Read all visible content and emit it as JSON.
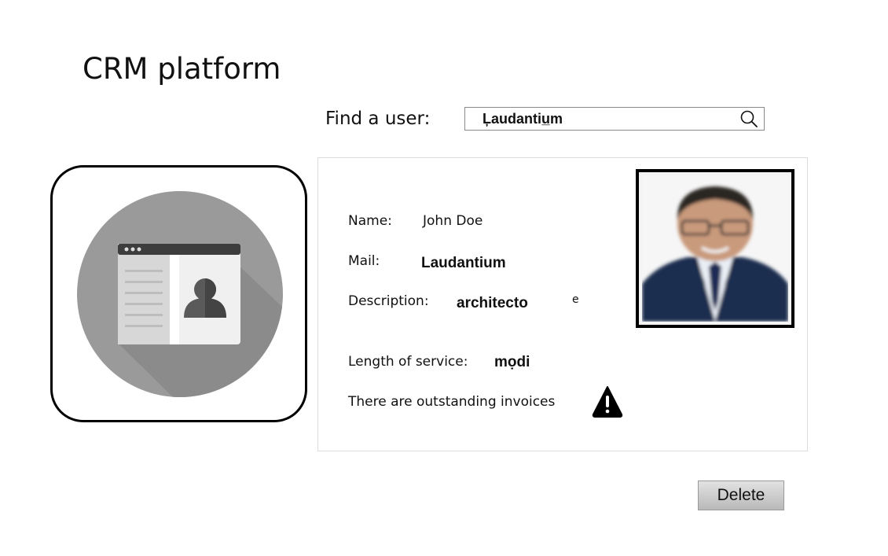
{
  "app": {
    "title": "CRM platform"
  },
  "search": {
    "label": "Find a user:",
    "value": "Ļaudantiu̲m"
  },
  "user": {
    "name_label": "Name:",
    "name": "John Doe",
    "mail_label": "Mail:",
    "mail": "Laudantium",
    "description_label": "Description:",
    "description": "architecto",
    "description_tail": "e",
    "service_label": "Length of service:",
    "service": "mọdi",
    "invoice_notice": "There are outstanding invoices"
  },
  "actions": {
    "delete_label": "Delete"
  },
  "icons": {
    "search": "search-icon",
    "app": "contact-card-icon",
    "warning": "warning-icon",
    "photo": "user-photo"
  },
  "colors": {
    "icon_circle": "#9a9a9a",
    "card_border": "#dcdcdc",
    "button_top": "#e2e2e2",
    "button_bottom": "#b9b9b9"
  }
}
